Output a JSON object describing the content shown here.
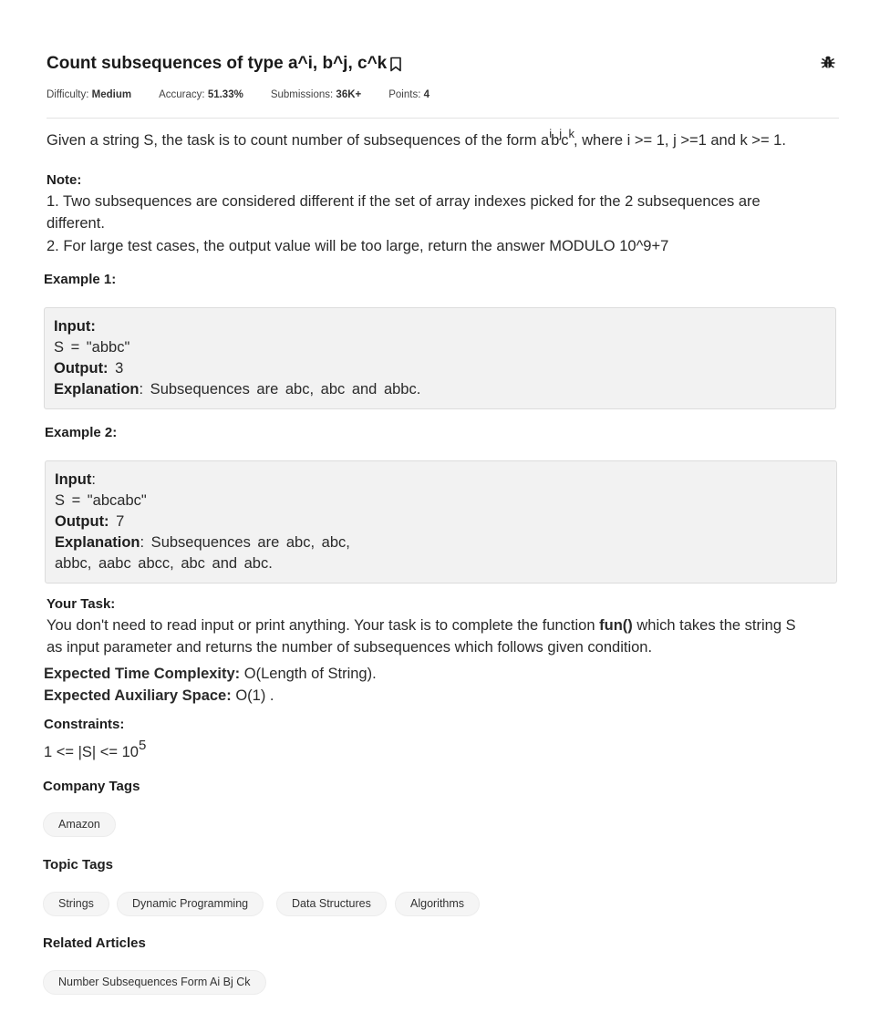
{
  "problem": {
    "title": "Count subsequences of type a^i, b^j, c^k",
    "meta": {
      "difficulty_label": "Difficulty:",
      "difficulty_value": "Medium",
      "accuracy_label": "Accuracy:",
      "accuracy_value": "51.33%",
      "submissions_label": "Submissions:",
      "submissions_value": "36K+",
      "points_label": "Points:",
      "points_value": "4"
    },
    "intro_prefix": "Given a string S, the task is to count number of subsequences of the form a",
    "intro_sup_i": "i",
    "intro_mid_b": "b",
    "intro_sup_j": "j",
    "intro_mid_c": "c",
    "intro_sup_k": "k",
    "intro_suffix": ", where i >= 1, j >=1 and k >= 1.",
    "note_heading": "Note:",
    "note_1_line1": "1. Two subsequences are considered different if the set of array indexes picked for the 2 subsequences are",
    "note_1_line2": "different.",
    "note_2": "2.  For large test cases, the output value will be too large, return the answer MODULO 10^9+7"
  },
  "examples": [
    {
      "heading": "Example 1:",
      "input_label": "Input:",
      "input_value": "S = \"abbc\"",
      "output_label": "Output:",
      "output_value": "3",
      "explanation_label": "Explanation",
      "explanation_line1": ": Subsequences are abc, abc and abbc.",
      "explanation_line2": ""
    },
    {
      "heading": "Example 2:",
      "input_label": "Input",
      "input_colon": ":",
      "input_value": "S = \"abcabc\"",
      "output_label": "Output:",
      "output_value": "7",
      "explanation_label": "Explanation",
      "explanation_line1": ": Subsequences are abc, abc,",
      "explanation_line2": "abbc, aabc abcc, abc and abc."
    }
  ],
  "task": {
    "heading": "Your Task:",
    "line1_prefix": "You don't need to read input or print anything. Your task is to complete the function ",
    "function_name": "fun()",
    "line1_suffix": " which takes the string S",
    "line2": "as input parameter and returns the number of subsequences which follows given condition.",
    "time_label": "Expected Time Complexity:",
    "time_value": " O(Length of String).",
    "space_label": "Expected Auxiliary Space:",
    "space_value": " O(1) ."
  },
  "constraints": {
    "heading": "Constraints:",
    "text": "1 <= |S| <= 10",
    "sup": "5"
  },
  "company_tags": {
    "heading": "Company Tags",
    "items": [
      "Amazon"
    ]
  },
  "topic_tags": {
    "heading": "Topic Tags",
    "items": [
      "Strings",
      "Dynamic Programming",
      "Data Structures",
      "Algorithms"
    ]
  },
  "related_articles": {
    "heading": "Related Articles",
    "items": [
      "Number Subsequences Form Ai Bj Ck"
    ]
  }
}
